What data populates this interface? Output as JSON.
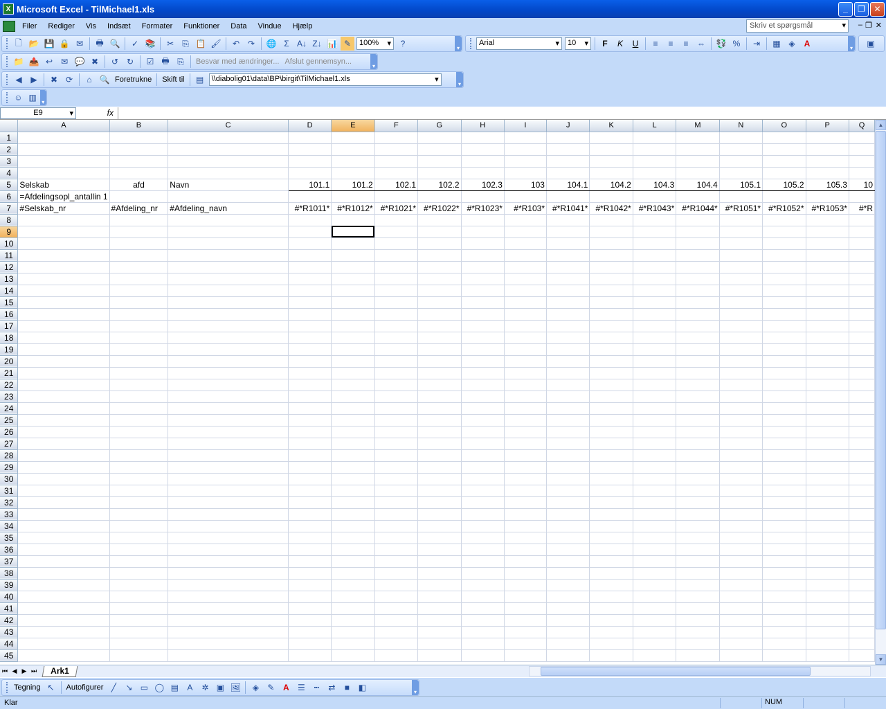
{
  "window": {
    "title": "Microsoft Excel - TilMichael1.xls"
  },
  "menu": {
    "items": [
      {
        "label": "Filer"
      },
      {
        "label": "Rediger"
      },
      {
        "label": "Vis"
      },
      {
        "label": "Indsæt"
      },
      {
        "label": "Formater"
      },
      {
        "label": "Funktioner"
      },
      {
        "label": "Data"
      },
      {
        "label": "Vindue"
      },
      {
        "label": "Hjælp"
      }
    ],
    "ask_placeholder": "Skriv et spørgsmål"
  },
  "toolbar": {
    "zoom": "100%",
    "font": "Arial",
    "font_size": "10"
  },
  "review_toolbar": {
    "reply_label": "Besvar med ændringer...",
    "end_review_label": "Afslut gennemsyn..."
  },
  "web_toolbar": {
    "favorites_label": "Foretrukne",
    "goto_label": "Skift til",
    "address": "\\\\diabolig01\\data\\BP\\birgit\\TilMichael1.xls"
  },
  "formula_bar": {
    "name_box": "E9",
    "fx": "fx",
    "value": ""
  },
  "sheet": {
    "active_cell": "E9",
    "columns": [
      "A",
      "B",
      "C",
      "D",
      "E",
      "F",
      "G",
      "H",
      "I",
      "J",
      "K",
      "L",
      "M",
      "N",
      "O",
      "P",
      "Q"
    ],
    "row_count": 45,
    "rows": {
      "5": {
        "A": "Selskab",
        "B": "afd",
        "C": "Navn",
        "D": "101.1",
        "E": "101.2",
        "F": "102.1",
        "G": "102.2",
        "H": "102.3",
        "I": "103",
        "J": "104.1",
        "K": "104.2",
        "L": "104.3",
        "M": "104.4",
        "N": "105.1",
        "O": "105.2",
        "P": "105.3",
        "Q": "10"
      },
      "6": {
        "A": "=Afdelingsopl_antallin 1"
      },
      "7": {
        "A": "#Selskab_nr",
        "B": "#Afdeling_nr",
        "C": "#Afdeling_navn",
        "D": "#*R1011*",
        "E": "#*R1012*",
        "F": "#*R1021*",
        "G": "#*R1022*",
        "H": "#*R1023*",
        "I": "#*R103*",
        "J": "#*R1041*",
        "K": "#*R1042*",
        "L": "#*R1043*",
        "M": "#*R1044*",
        "N": "#*R1051*",
        "O": "#*R1052*",
        "P": "#*R1053*",
        "Q": "#*R"
      }
    }
  },
  "sheet_tabs": [
    {
      "label": "Ark1"
    }
  ],
  "drawing_toolbar": {
    "draw_label": "Tegning",
    "autoshapes_label": "Autofigurer"
  },
  "status": {
    "text": "Klar",
    "num": "NUM"
  }
}
